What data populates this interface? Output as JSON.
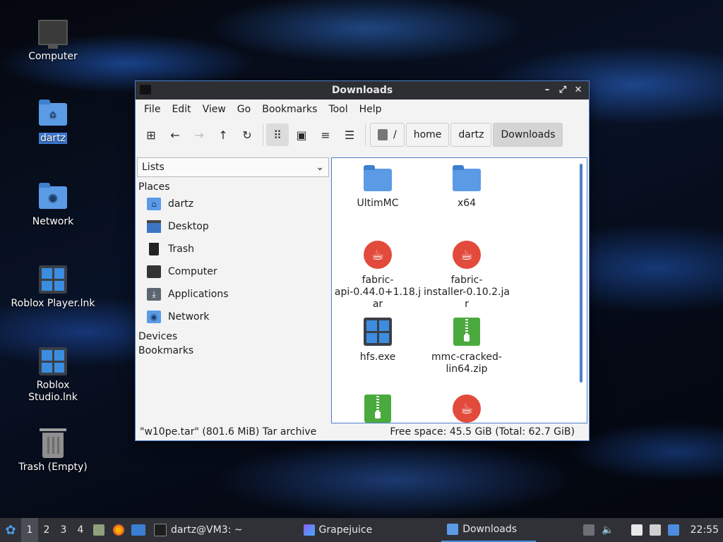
{
  "desktop": {
    "icons": [
      {
        "label": "Computer"
      },
      {
        "label": "dartz"
      },
      {
        "label": "Network"
      },
      {
        "label": "Roblox Player.lnk"
      },
      {
        "label": "Roblox Studio.lnk"
      },
      {
        "label": "Trash (Empty)"
      }
    ]
  },
  "window": {
    "title": "Downloads",
    "controls": {
      "minimize": "–",
      "maximize": "⤢",
      "close": "✕"
    },
    "menu": [
      "File",
      "Edit",
      "View",
      "Go",
      "Bookmarks",
      "Tool",
      "Help"
    ],
    "toolbar": {
      "new_tab": "⊞",
      "back": "←",
      "forward": "→",
      "up": "↑",
      "reload": "↻",
      "view_icons": "⠿",
      "view_thumbs": "▣",
      "view_compact": "≡",
      "view_list": "☰"
    },
    "breadcrumbs": [
      "/",
      "home",
      "dartz",
      "Downloads"
    ],
    "sidepane": {
      "mode": "Lists",
      "places_header": "Places",
      "places": [
        "dartz",
        "Desktop",
        "Trash",
        "Computer",
        "Applications",
        "Network"
      ],
      "devices_header": "Devices",
      "bookmarks_header": "Bookmarks"
    },
    "files": [
      {
        "name": "UltimMC",
        "type": "folder"
      },
      {
        "name": "x64",
        "type": "folder"
      },
      {
        "name": "fabric-\napi-0.44.0+1.18.j\nar",
        "type": "java"
      },
      {
        "name": "fabric-\ninstaller-0.10.2.ja\nr",
        "type": "java"
      },
      {
        "name": "hfs.exe",
        "type": "exe"
      },
      {
        "name": "mmc-cracked-\nlin64.zip",
        "type": "zip"
      },
      {
        "name": "",
        "type": "zip"
      },
      {
        "name": "",
        "type": "java"
      }
    ],
    "status": {
      "selection": "\"w10pe.tar\" (801.6 MiB) Tar archive",
      "free_space": "Free space: 45.5 GiB (Total: 62.7 GiB)"
    }
  },
  "taskbar": {
    "workspaces": [
      "1",
      "2",
      "3",
      "4"
    ],
    "tasks": [
      {
        "label": "dartz@VM3: ~"
      },
      {
        "label": "Grapejuice"
      },
      {
        "label": "Downloads"
      }
    ],
    "clock": "22:55"
  },
  "colors": {
    "accent": "#4d7fc9",
    "folder": "#5b9be6",
    "java": "#e24a3b",
    "zip": "#4aaa3d",
    "taskbar": "#2f3136"
  }
}
